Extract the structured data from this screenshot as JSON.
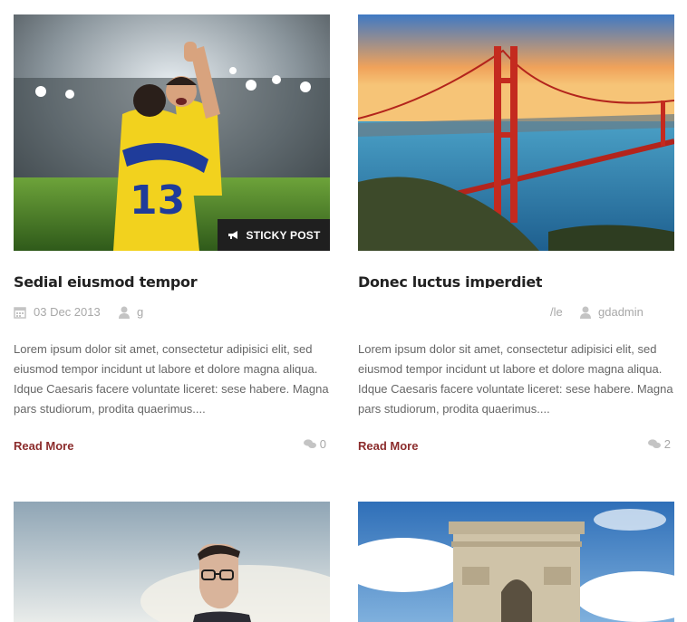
{
  "posts": [
    {
      "title": "Sedial eiusmod tempor",
      "sticky_label": "STICKY POST",
      "date": "03 Dec 2013",
      "author": "g",
      "excerpt": "Lorem ipsum dolor sit amet, consectetur adipisici elit, sed eiusmod tempor incidunt ut labore et dolore magna aliqua. Idque Caesaris facere voluntate liceret: sese habere. Magna pars studiorum, prodita quaerimus....",
      "read_more": "Read More",
      "comments": "0"
    },
    {
      "title": "Donec luctus imperdiet",
      "category": "/le",
      "author": "gdadmin",
      "excerpt": "Lorem ipsum dolor sit amet, consectetur adipisici elit, sed eiusmod tempor incidunt ut labore et dolore magna aliqua. Idque Caesaris facere voluntate liceret: sese habere. Magna pars studiorum, prodita quaerimus....",
      "read_more": "Read More",
      "comments": "2"
    }
  ],
  "colors": {
    "accent": "#8b2c2c",
    "meta": "#a8a8a8",
    "sticky_bg": "#1f1f1f"
  },
  "icons": [
    "megaphone-icon",
    "calendar-icon",
    "user-icon",
    "comments-icon"
  ]
}
